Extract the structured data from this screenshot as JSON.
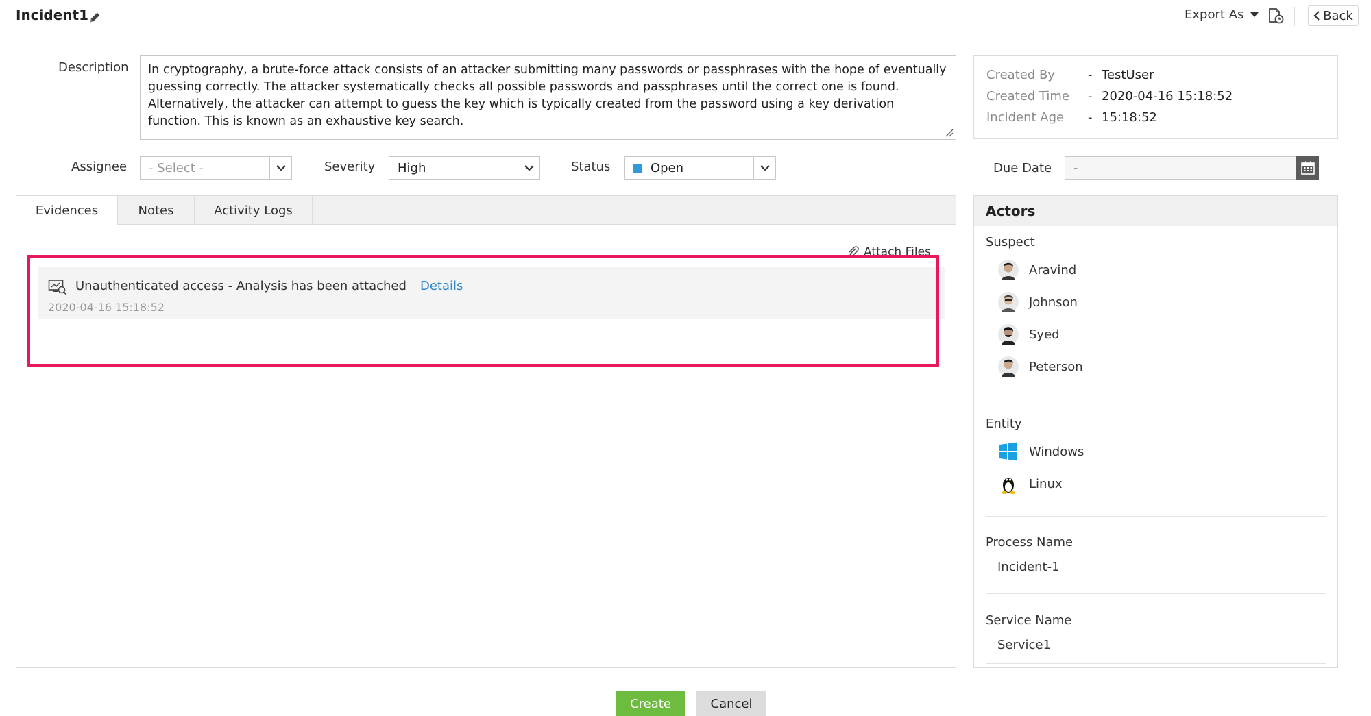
{
  "header": {
    "title": "Incident1",
    "export_label": "Export As",
    "back_label": "Back"
  },
  "description": {
    "label": "Description",
    "text": "In cryptography, a brute-force attack consists of an attacker submitting many passwords or passphrases with the hope of eventually guessing correctly. The attacker systematically checks all possible passwords and passphrases until the correct one is found. Alternatively, the attacker can attempt to guess the key which is typically created from the password using a key derivation function. This is known as an exhaustive key search."
  },
  "info": {
    "created_by_label": "Created By",
    "created_by": "TestUser",
    "created_time_label": "Created Time",
    "created_time": "2020-04-16 15:18:52",
    "incident_age_label": "Incident Age",
    "incident_age": "15:18:52",
    "separator": "-"
  },
  "form": {
    "assignee_label": "Assignee",
    "assignee_value": "- Select -",
    "severity_label": "Severity",
    "severity_value": "High",
    "status_label": "Status",
    "status_value": "Open",
    "status_color": "#2f9bd8",
    "due_date_label": "Due Date",
    "due_date_value": "-"
  },
  "tabs": [
    {
      "label": "Evidences",
      "active": true
    },
    {
      "label": "Notes",
      "active": false
    },
    {
      "label": "Activity Logs",
      "active": false
    }
  ],
  "evidences": {
    "attach_label": "Attach Files",
    "items": [
      {
        "text": "Unauthenticated access - Analysis has been attached",
        "link": "Details",
        "time": "2020-04-16 15:18:52"
      }
    ]
  },
  "actors": {
    "title": "Actors",
    "suspect_label": "Suspect",
    "suspects": [
      "Aravind",
      "Johnson",
      "Syed",
      "Peterson"
    ],
    "entity_label": "Entity",
    "entities": [
      {
        "name": "Windows",
        "icon": "windows-icon"
      },
      {
        "name": "Linux",
        "icon": "linux-icon"
      }
    ],
    "process_label": "Process Name",
    "process_value": "Incident-1",
    "service_label": "Service Name",
    "service_value": "Service1"
  },
  "footer": {
    "create_label": "Create",
    "cancel_label": "Cancel"
  },
  "colors": {
    "highlight": "#e8185a",
    "link": "#2a86c8",
    "create_button": "#6dbb3f"
  }
}
